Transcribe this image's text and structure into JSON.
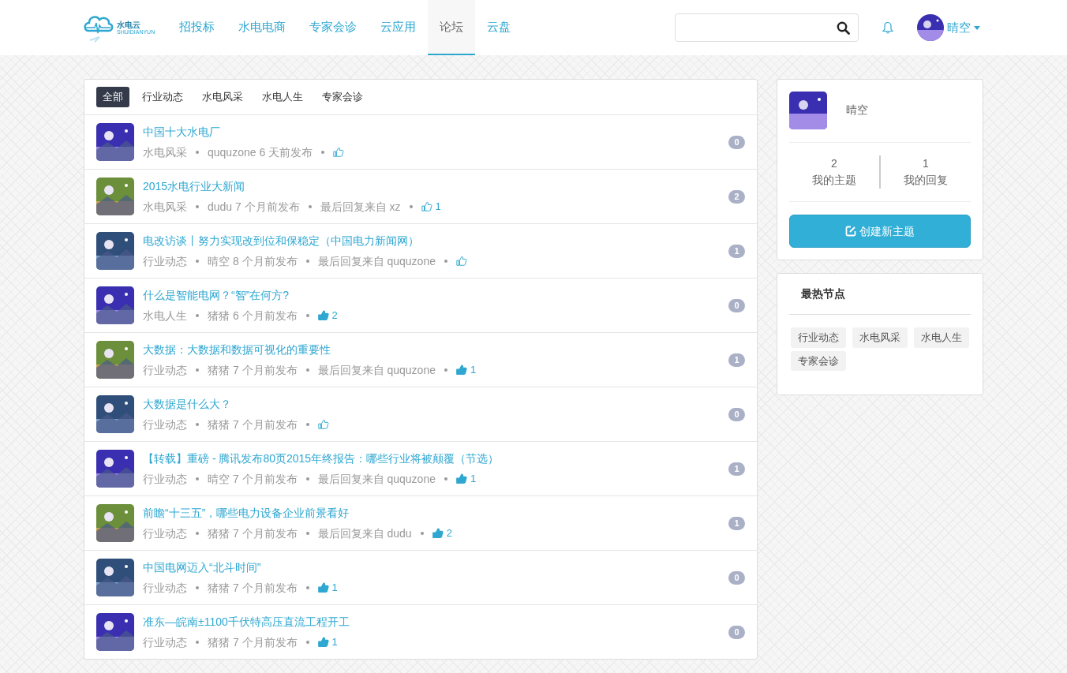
{
  "logo": {
    "name": "水电云",
    "subtitle": "SHUIDIANYUN"
  },
  "nav": [
    {
      "label": "招投标",
      "selected": false
    },
    {
      "label": "水电电商",
      "selected": false
    },
    {
      "label": "专家会诊",
      "selected": false
    },
    {
      "label": "云应用",
      "selected": false
    },
    {
      "label": "论坛",
      "selected": true
    },
    {
      "label": "云盘",
      "selected": false
    }
  ],
  "user_menu": {
    "name": "晴空"
  },
  "filter_tabs": [
    {
      "label": "全部",
      "selected": true
    },
    {
      "label": "行业动态",
      "selected": false
    },
    {
      "label": "水电风采",
      "selected": false
    },
    {
      "label": "水电人生",
      "selected": false
    },
    {
      "label": "专家会诊",
      "selected": false
    }
  ],
  "topics": [
    {
      "title": "中国十大水电厂",
      "node": "水电风采",
      "author": "ququzone",
      "time": "6 天前发布",
      "liked": false,
      "replies": "0"
    },
    {
      "title": "2015水电行业大新闻",
      "node": "水电风采",
      "author": "dudu",
      "time": "7 个月前发布",
      "last_reply": "最后回复来自 xz",
      "liked": false,
      "likes": "1",
      "replies": "2"
    },
    {
      "title": "电改访谈丨努力实现改到位和保稳定（中国电力新闻网）",
      "node": "行业动态",
      "author": "晴空",
      "time": "8 个月前发布",
      "last_reply": "最后回复来自 ququzone",
      "liked": false,
      "replies": "1"
    },
    {
      "title": "什么是智能电网？“智”在何方?",
      "node": "水电人生",
      "author": "猪猪",
      "time": "6 个月前发布",
      "liked": true,
      "likes": "2",
      "replies": "0"
    },
    {
      "title": "大数据：大数据和数据可视化的重要性",
      "node": "行业动态",
      "author": "猪猪",
      "time": "7 个月前发布",
      "last_reply": "最后回复来自 ququzone",
      "liked": true,
      "likes": "1",
      "replies": "1"
    },
    {
      "title": "大数据是什么大？",
      "node": "行业动态",
      "author": "猪猪",
      "time": "7 个月前发布",
      "liked": false,
      "replies": "0"
    },
    {
      "title": "【转载】重磅 - 腾讯发布80页2015年终报告：哪些行业将被颠覆（节选）",
      "node": "行业动态",
      "author": "晴空",
      "time": "7 个月前发布",
      "last_reply": "最后回复来自 ququzone",
      "liked": true,
      "likes": "1",
      "replies": "1"
    },
    {
      "title": "前瞻“十三五”，哪些电力设备企业前景看好",
      "node": "行业动态",
      "author": "猪猪",
      "time": "7 个月前发布",
      "last_reply": "最后回复来自 dudu",
      "liked": true,
      "likes": "2",
      "replies": "1"
    },
    {
      "title": "中国电网迈入“北斗时间”",
      "node": "行业动态",
      "author": "猪猪",
      "time": "7 个月前发布",
      "liked": true,
      "likes": "1",
      "replies": "0"
    },
    {
      "title": "准东—皖南±1100千伏特高压直流工程开工",
      "node": "行业动态",
      "author": "猪猪",
      "time": "7 个月前发布",
      "liked": true,
      "likes": "1",
      "replies": "0"
    }
  ],
  "profile": {
    "name": "晴空",
    "stats": [
      {
        "value": "2",
        "label": "我的主题"
      },
      {
        "value": "1",
        "label": "我的回复"
      }
    ],
    "button": "创建新主题"
  },
  "hot_nodes": {
    "title": "最热节点",
    "tags": [
      "行业动态",
      "水电风采",
      "水电人生",
      "专家会诊"
    ]
  }
}
